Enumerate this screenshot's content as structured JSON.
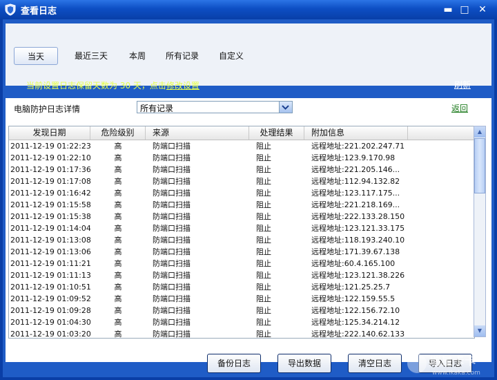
{
  "window": {
    "title": "查看日志",
    "minimize": "▬",
    "maximize": "□",
    "close": "✕"
  },
  "tabs": [
    {
      "label": "当天",
      "active": true
    },
    {
      "label": "最近三天",
      "active": false
    },
    {
      "label": "本周",
      "active": false
    },
    {
      "label": "所有记录",
      "active": false
    },
    {
      "label": "自定义",
      "active": false
    }
  ],
  "retention": {
    "text_prefix": "当前设置日志保留天数为 30 天，点击",
    "link": "修改设置"
  },
  "refresh_label": "刷新",
  "filter": {
    "label": "电脑防护日志详情",
    "selected": "所有记录"
  },
  "back_label": "返回",
  "table": {
    "columns": [
      "发现日期",
      "危险级别",
      "来源",
      "处理结果",
      "附加信息"
    ],
    "rows": [
      [
        "2011-12-19 01:22:23",
        "高",
        "防端口扫描",
        "阻止",
        "远程地址:221.202.247.71"
      ],
      [
        "2011-12-19 01:22:10",
        "高",
        "防端口扫描",
        "阻止",
        "远程地址:123.9.170.98"
      ],
      [
        "2011-12-19 01:17:36",
        "高",
        "防端口扫描",
        "阻止",
        "远程地址:221.205.146..."
      ],
      [
        "2011-12-19 01:17:08",
        "高",
        "防端口扫描",
        "阻止",
        "远程地址:112.94.132.82"
      ],
      [
        "2011-12-19 01:16:42",
        "高",
        "防端口扫描",
        "阻止",
        "远程地址:123.117.175..."
      ],
      [
        "2011-12-19 01:15:58",
        "高",
        "防端口扫描",
        "阻止",
        "远程地址:221.218.169..."
      ],
      [
        "2011-12-19 01:15:38",
        "高",
        "防端口扫描",
        "阻止",
        "远程地址:222.133.28.150"
      ],
      [
        "2011-12-19 01:14:04",
        "高",
        "防端口扫描",
        "阻止",
        "远程地址:123.121.33.175"
      ],
      [
        "2011-12-19 01:13:08",
        "高",
        "防端口扫描",
        "阻止",
        "远程地址:118.193.240.10"
      ],
      [
        "2011-12-19 01:13:06",
        "高",
        "防端口扫描",
        "阻止",
        "远程地址:171.39.67.138"
      ],
      [
        "2011-12-19 01:11:21",
        "高",
        "防端口扫描",
        "阻止",
        "远程地址:60.4.165.100"
      ],
      [
        "2011-12-19 01:11:13",
        "高",
        "防端口扫描",
        "阻止",
        "远程地址:123.121.38.226"
      ],
      [
        "2011-12-19 01:10:51",
        "高",
        "防端口扫描",
        "阻止",
        "远程地址:121.25.25.7"
      ],
      [
        "2011-12-19 01:09:52",
        "高",
        "防端口扫描",
        "阻止",
        "远程地址:122.159.55.5"
      ],
      [
        "2011-12-19 01:09:28",
        "高",
        "防端口扫描",
        "阻止",
        "远程地址:122.156.72.10"
      ],
      [
        "2011-12-19 01:04:30",
        "高",
        "防端口扫描",
        "阻止",
        "远程地址:125.34.214.12"
      ],
      [
        "2011-12-19 01:03:20",
        "高",
        "防端口扫描",
        "阻止",
        "远程地址:222.140.62.133"
      ]
    ]
  },
  "buttons": {
    "backup": "备份日志",
    "export": "导出数据",
    "clear": "清空日志",
    "import": "导入日志"
  },
  "watermark": {
    "text": "瑞星卡卡",
    "url": "www.ikaka.com"
  },
  "colors": {
    "titlebar": "#0d4ec3",
    "accent_text": "#e6ff4b",
    "link_green": "#1c7a1c"
  }
}
